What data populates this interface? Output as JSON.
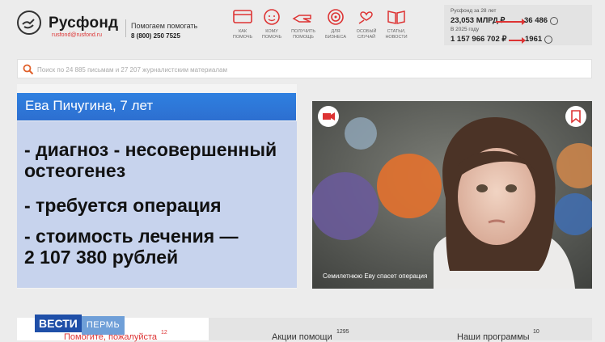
{
  "header": {
    "logo_title": "Русфонд",
    "logo_email": "rusfond@rusfond.ru",
    "tagline": "Помогаем помогать",
    "phone": "8 (800) 250 7525"
  },
  "nav": [
    {
      "label_1": "КАК",
      "label_2": "ПОМОЧЬ",
      "icon": "card-icon"
    },
    {
      "label_1": "КОМУ",
      "label_2": "ПОМОЧЬ",
      "icon": "face-icon"
    },
    {
      "label_1": "ПОЛУЧИТЬ",
      "label_2": "ПОМОЩЬ",
      "icon": "hand-icon"
    },
    {
      "label_1": "ДЛЯ",
      "label_2": "БИЗНЕСА",
      "icon": "target-icon"
    },
    {
      "label_1": "ОСОБЫЙ",
      "label_2": "СЛУЧАЙ",
      "icon": "heart-hand-icon"
    },
    {
      "label_1": "СТАТЬИ,",
      "label_2": "НОВОСТИ",
      "icon": "book-icon"
    }
  ],
  "stats": {
    "period": "Русфонд за 28 лет",
    "total_amount": "23,053 МЛРД ₽",
    "total_count": "36 486",
    "year_label": "В 2025 году",
    "year_amount": "1 157 966 702 ₽",
    "year_count": "1961"
  },
  "search": {
    "placeholder": "Поиск по 24 885 письмам и 27 207 журналистским материалам"
  },
  "overlay": {
    "title": "Ева Пичугина, 7 лет",
    "line1": "- диагноз - несовершенный",
    "line2": "остеогенез",
    "line3": "- требуется операция",
    "line4": "- стоимость лечения —",
    "line5": "2 107 380 рублей"
  },
  "photo": {
    "caption": "Семилетнюю Еву спасет операция"
  },
  "tabs": [
    {
      "label": "Помогите, пожалуйста",
      "count": "12"
    },
    {
      "label": "Акции помощи",
      "count": "1295"
    },
    {
      "label": "Наши программы",
      "count": "10"
    }
  ],
  "watermark": {
    "brand_1": "ВЕСТИ",
    "brand_2": "ПЕРМЬ"
  },
  "colors": {
    "accent": "#d33333",
    "overlay_blue": "#2d6fd0"
  }
}
